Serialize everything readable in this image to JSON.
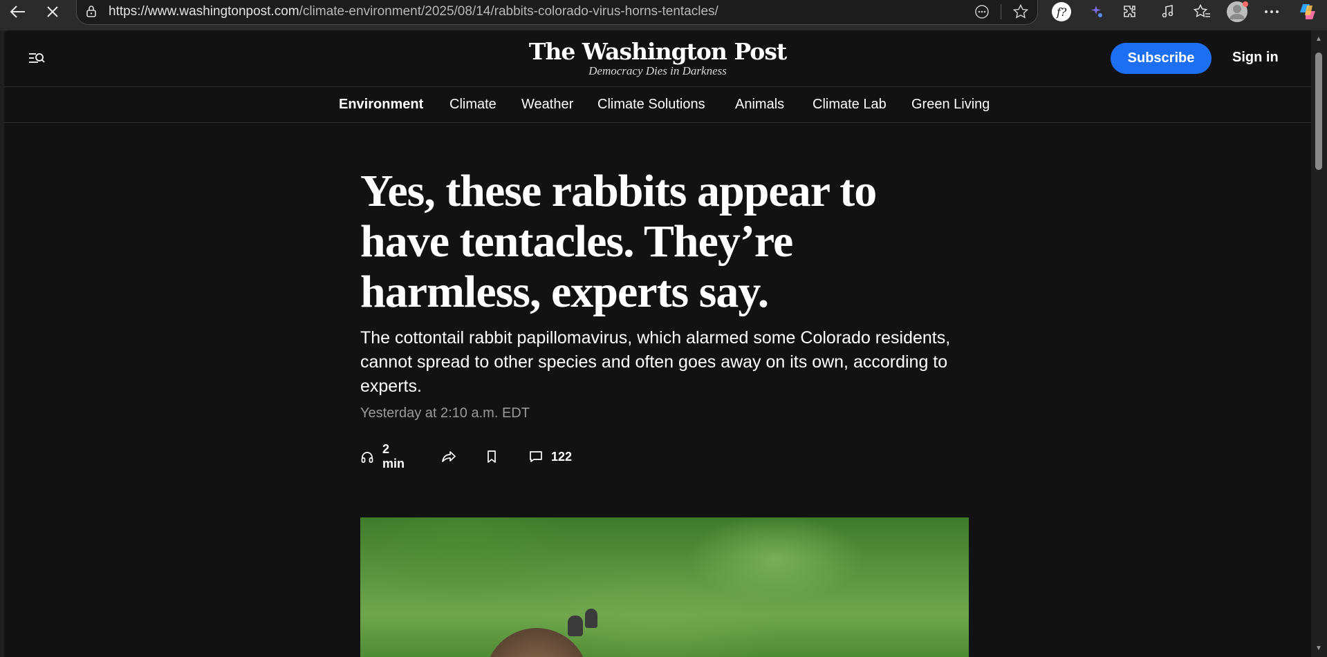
{
  "browser": {
    "url_host": "https://www.washingtonpost.com",
    "url_path": "/climate-environment/2025/08/14/rabbits-colorado-virus-horns-tentacles/",
    "toolbar_icons": [
      "back-icon",
      "stop-loading-icon",
      "site-info-icon",
      "reader-options-icon",
      "favorite-star-icon",
      "extension-f-icon",
      "extension-sparkle-icon",
      "extensions-puzzle-icon",
      "media-control-icon",
      "favorites-icon",
      "profile-avatar-icon",
      "more-menu-icon",
      "copilot-icon"
    ]
  },
  "masthead": {
    "logo_name": "The Washington Post",
    "logo_tagline": "Democracy Dies in Darkness",
    "subscribe_label": "Subscribe",
    "signin_label": "Sign in",
    "accent_color": "#1d6ff2"
  },
  "sections": [
    {
      "label": "Environment",
      "active": true
    },
    {
      "label": "Climate"
    },
    {
      "label": "Weather"
    },
    {
      "label": "Climate Solutions"
    },
    {
      "label": "Animals"
    },
    {
      "label": "Climate Lab"
    },
    {
      "label": "Green Living"
    }
  ],
  "article": {
    "headline": "Yes, these rabbits appear to have tentacles. They’re harmless, experts say.",
    "dek": "The cottontail rabbit papillomavirus, which alarmed some Colorado residents, cannot spread to other species and often goes away on its own, according to experts.",
    "timestamp": "Yesterday at 2:10 a.m. EDT",
    "listen_label": "2 min",
    "comment_count": "122"
  }
}
